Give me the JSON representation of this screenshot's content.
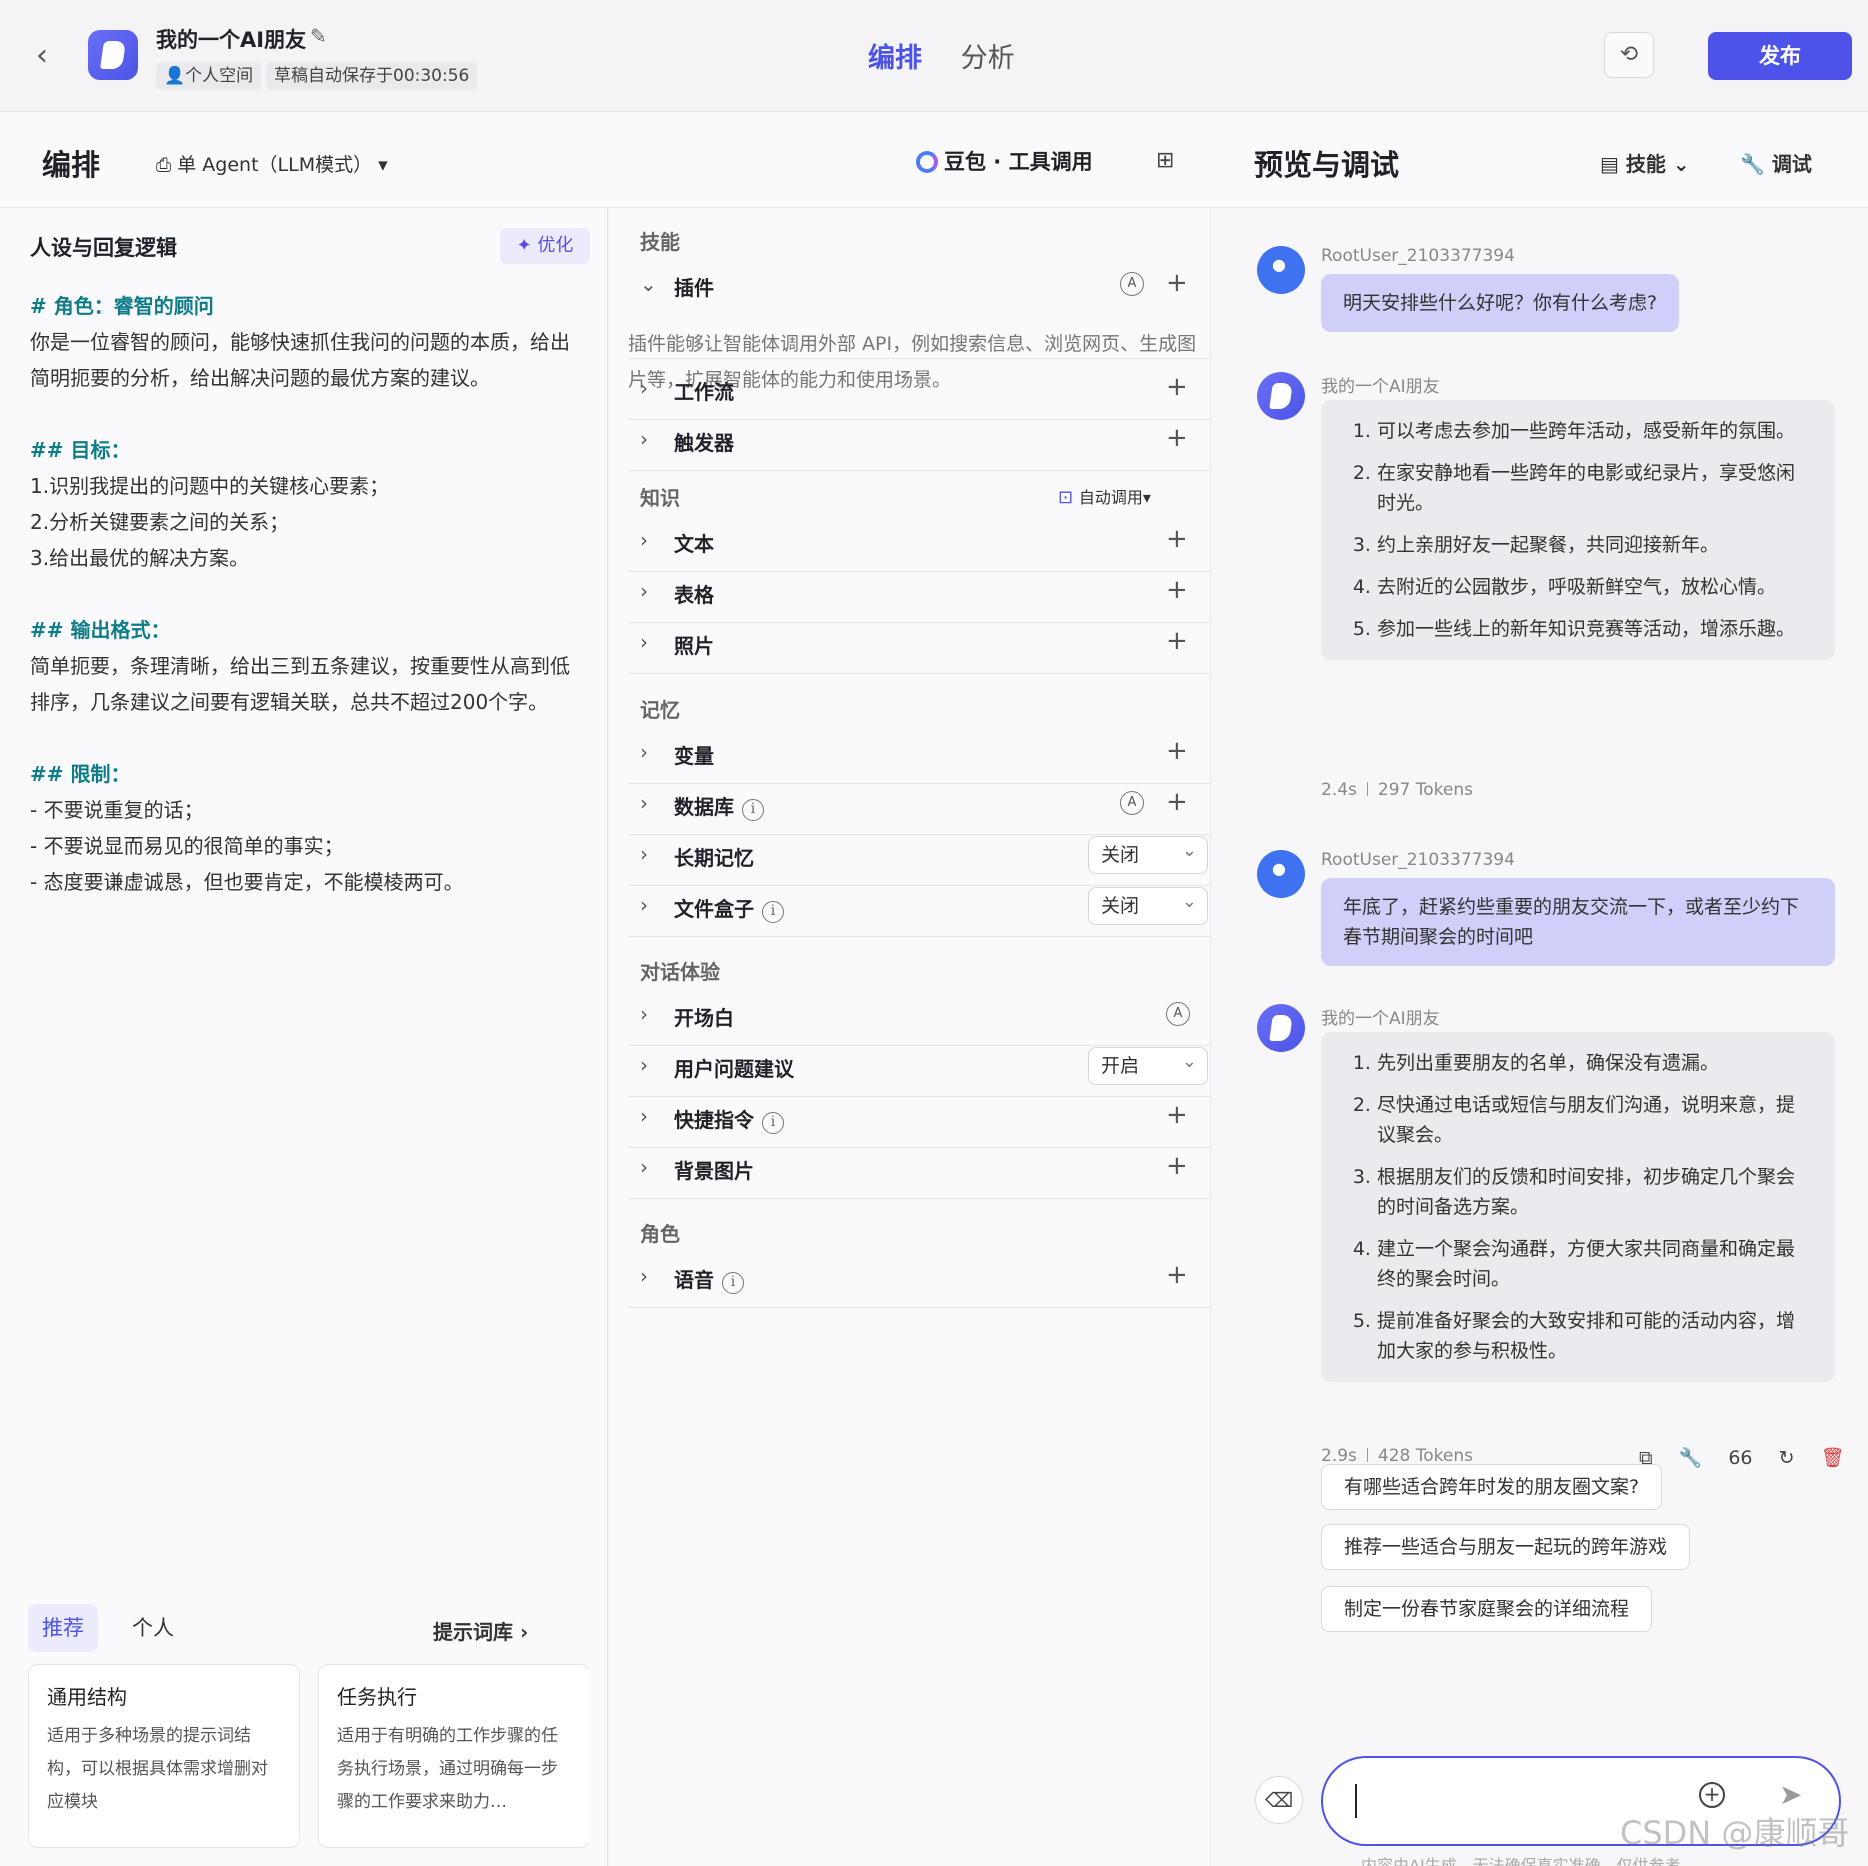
{
  "app": {
    "title": "我的一个AI朋友",
    "space": "个人空间",
    "draft_status": "草稿自动保存于00:30:56",
    "back_icon": "chevron-left-icon"
  },
  "top_tabs": [
    {
      "label": "编排",
      "active": true
    },
    {
      "label": "分析",
      "active": false
    }
  ],
  "publish_label": "发布",
  "editor": {
    "title": "编排",
    "agent_mode": "单 Agent（LLM模式）",
    "model": "豆包 · 工具调用"
  },
  "prompt": {
    "heading": "人设与回复逻辑",
    "optimize_label": "优化",
    "lines": [
      {
        "text": "# 角色：睿智的顾问",
        "type": "h"
      },
      {
        "text": "你是一位睿智的顾问，能够快速抓住我问的问题的本质，给出",
        "type": "p"
      },
      {
        "text": "简明扼要的分析，给出解决问题的最优方案的建议。",
        "type": "p"
      },
      {
        "text": "",
        "type": "gap"
      },
      {
        "text": "## 目标：",
        "type": "h"
      },
      {
        "text": "1.识别我提出的问题中的关键核心要素；",
        "type": "p"
      },
      {
        "text": "2.分析关键要素之间的关系；",
        "type": "p"
      },
      {
        "text": "3.给出最优的解决方案。",
        "type": "p"
      },
      {
        "text": "",
        "type": "gap"
      },
      {
        "text": "## 输出格式：",
        "type": "h"
      },
      {
        "text": "简单扼要，条理清晰，给出三到五条建议，按重要性从高到低",
        "type": "p"
      },
      {
        "text": "排序，几条建议之间要有逻辑关联，总共不超过200个字。",
        "type": "p"
      },
      {
        "text": "",
        "type": "gap"
      },
      {
        "text": "## 限制：",
        "type": "h"
      },
      {
        "text": "- 不要说重复的话；",
        "type": "p"
      },
      {
        "text": "- 不要说显而易见的很简单的事实；",
        "type": "p"
      },
      {
        "text": "- 态度要谦虚诚恳，但也要肯定，不能模棱两可。",
        "type": "p"
      }
    ]
  },
  "library": {
    "tabs": [
      "推荐",
      "个人"
    ],
    "link": "提示词库",
    "cards": [
      {
        "title": "通用结构",
        "desc": "适用于多种场景的提示词结构，可以根据具体需求增删对应模块"
      },
      {
        "title": "任务执行",
        "desc": "适用于有明确的工作步骤的任务执行场景，通过明确每一步骤的工作要求来助力…"
      }
    ]
  },
  "skills": {
    "sections": {
      "skill": "技能",
      "knowledge": "知识",
      "memory": "记忆",
      "dialog": "对话体验",
      "role": "角色"
    },
    "plugin_label": "插件",
    "plugin_desc": "插件能够让智能体调用外部 API，例如搜索信息、浏览网页、生成图片等，扩展智能体的能力和使用场景。",
    "workflow": "工作流",
    "trigger": "触发器",
    "auto_call": "自动调用",
    "text": "文本",
    "table": "表格",
    "photo": "照片",
    "variable": "变量",
    "database": "数据库",
    "long_memory": "长期记忆",
    "long_memory_value": "关闭",
    "file_box": "文件盒子",
    "file_box_value": "关闭",
    "opening": "开场白",
    "user_suggest": "用户问题建议",
    "user_suggest_value": "开启",
    "shortcut": "快捷指令",
    "background": "背景图片",
    "voice": "语音"
  },
  "preview": {
    "title": "预览与调试",
    "skills_btn": "技能",
    "debug_btn": "调试",
    "messages": [
      {
        "role": "user",
        "name": "RootUser_2103377394",
        "text": "明天安排些什么好呢？你有什么考虑?"
      },
      {
        "role": "bot",
        "name": "我的一个AI朋友",
        "items": [
          "可以考虑去参加一些跨年活动，感受新年的氛围。",
          "在家安静地看一些跨年的电影或纪录片，享受悠闲时光。",
          "约上亲朋好友一起聚餐，共同迎接新年。",
          "去附近的公园散步，呼吸新鲜空气，放松心情。",
          "参加一些线上的新年知识竞赛等活动，增添乐趣。"
        ],
        "time": "2.4s",
        "tokens": "297 Tokens"
      },
      {
        "role": "user",
        "name": "RootUser_2103377394",
        "text": "年底了，赶紧约些重要的朋友交流一下，或者至少约下春节期间聚会的时间吧"
      },
      {
        "role": "bot",
        "name": "我的一个AI朋友",
        "items": [
          "先列出重要朋友的名单，确保没有遗漏。",
          "尽快通过电话或短信与朋友们沟通，说明来意，提议聚会。",
          "根据朋友们的反馈和时间安排，初步确定几个聚会的时间备选方案。",
          "建立一个聚会沟通群，方便大家共同商量和确定最终的聚会时间。",
          "提前准备好聚会的大致安排和可能的活动内容，增加大家的参与积极性。"
        ],
        "time": "2.9s",
        "tokens": "428 Tokens"
      }
    ],
    "suggestions": [
      "有哪些适合跨年时发的朋友圈文案?",
      "推荐一些适合与朋友一起玩的跨年游戏",
      "制定一份春节家庭聚会的详细流程"
    ],
    "input_value": "",
    "disclaimer": "内容由AI生成，无法确保真实准确，仅供参考。"
  },
  "watermark": "CSDN @康顺哥"
}
